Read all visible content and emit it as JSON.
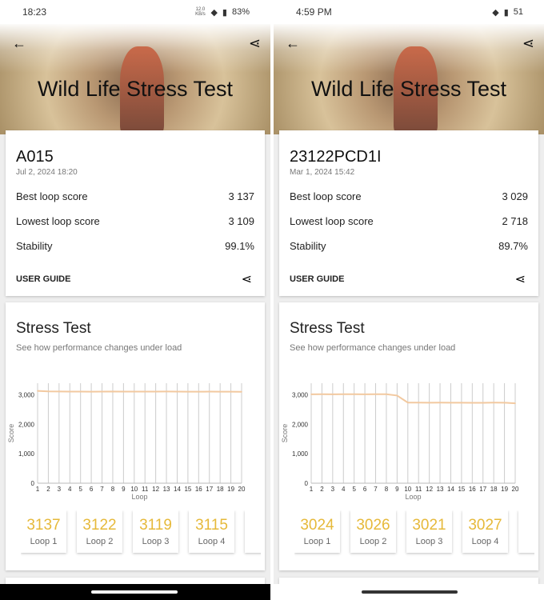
{
  "phones": [
    {
      "status": {
        "time": "18:23",
        "icons": [
          "whatsapp-icon",
          "cloud-icon"
        ],
        "net_speed": "12.0 KB/s",
        "battery": "83%"
      },
      "title": "Wild Life Stress Test",
      "device": "A015",
      "date": "Jul 2, 2024 18:20",
      "rows": [
        {
          "label": "Best loop score",
          "value": "3 137"
        },
        {
          "label": "Lowest loop score",
          "value": "3 109"
        },
        {
          "label": "Stability",
          "value": "99.1%"
        }
      ],
      "user_guide": "USER GUIDE",
      "stress": {
        "title": "Stress Test",
        "subtitle": "See how performance changes under load"
      },
      "loops": [
        {
          "value": "3137",
          "label": "Loop 1"
        },
        {
          "value": "3122",
          "label": "Loop 2"
        },
        {
          "value": "3119",
          "label": "Loop 3"
        },
        {
          "value": "3115",
          "label": "Loop 4"
        },
        {
          "value": "3",
          "label": ""
        }
      ],
      "nav_bar": "dark"
    },
    {
      "status": {
        "time": "4:59 PM",
        "icons": [
          "message-icon",
          "netflix-icon",
          "youtube-icon"
        ],
        "battery": "51"
      },
      "title": "Wild Life Stress Test",
      "device": "23122PCD1I",
      "date": "Mar 1, 2024 15:42",
      "rows": [
        {
          "label": "Best loop score",
          "value": "3 029"
        },
        {
          "label": "Lowest loop score",
          "value": "2 718"
        },
        {
          "label": "Stability",
          "value": "89.7%"
        }
      ],
      "user_guide": "USER GUIDE",
      "stress": {
        "title": "Stress Test",
        "subtitle": "See how performance changes under load"
      },
      "loops": [
        {
          "value": "3024",
          "label": "Loop 1"
        },
        {
          "value": "3026",
          "label": "Loop 2"
        },
        {
          "value": "3021",
          "label": "Loop 3"
        },
        {
          "value": "3027",
          "label": "Loop 4"
        },
        {
          "value": "",
          "label": ""
        }
      ],
      "nav_bar": "light"
    }
  ],
  "chart_data": [
    {
      "type": "line",
      "xlabel": "Loop",
      "ylabel": "Score",
      "x": [
        1,
        2,
        3,
        4,
        5,
        6,
        7,
        8,
        9,
        10,
        11,
        12,
        13,
        14,
        15,
        16,
        17,
        18,
        19,
        20
      ],
      "y": [
        3137,
        3122,
        3119,
        3115,
        3115,
        3112,
        3113,
        3118,
        3114,
        3115,
        3116,
        3114,
        3117,
        3115,
        3112,
        3111,
        3113,
        3112,
        3110,
        3109
      ],
      "yticks": [
        "0",
        "1,000",
        "2,000",
        "3,000"
      ],
      "ylim": [
        0,
        3400
      ],
      "color": "#f2c9a0",
      "grid": "vertical"
    },
    {
      "type": "line",
      "xlabel": "Loop",
      "ylabel": "Score",
      "x": [
        1,
        2,
        3,
        4,
        5,
        6,
        7,
        8,
        9,
        10,
        11,
        12,
        13,
        14,
        15,
        16,
        17,
        18,
        19,
        20
      ],
      "y": [
        3024,
        3026,
        3021,
        3027,
        3025,
        3024,
        3026,
        3025,
        2980,
        2740,
        2740,
        2738,
        2740,
        2738,
        2736,
        2735,
        2735,
        2740,
        2738,
        2718
      ],
      "yticks": [
        "0",
        "1,000",
        "2,000",
        "3,000"
      ],
      "ylim": [
        0,
        3400
      ],
      "color": "#f2c9a0",
      "grid": "vertical"
    }
  ]
}
